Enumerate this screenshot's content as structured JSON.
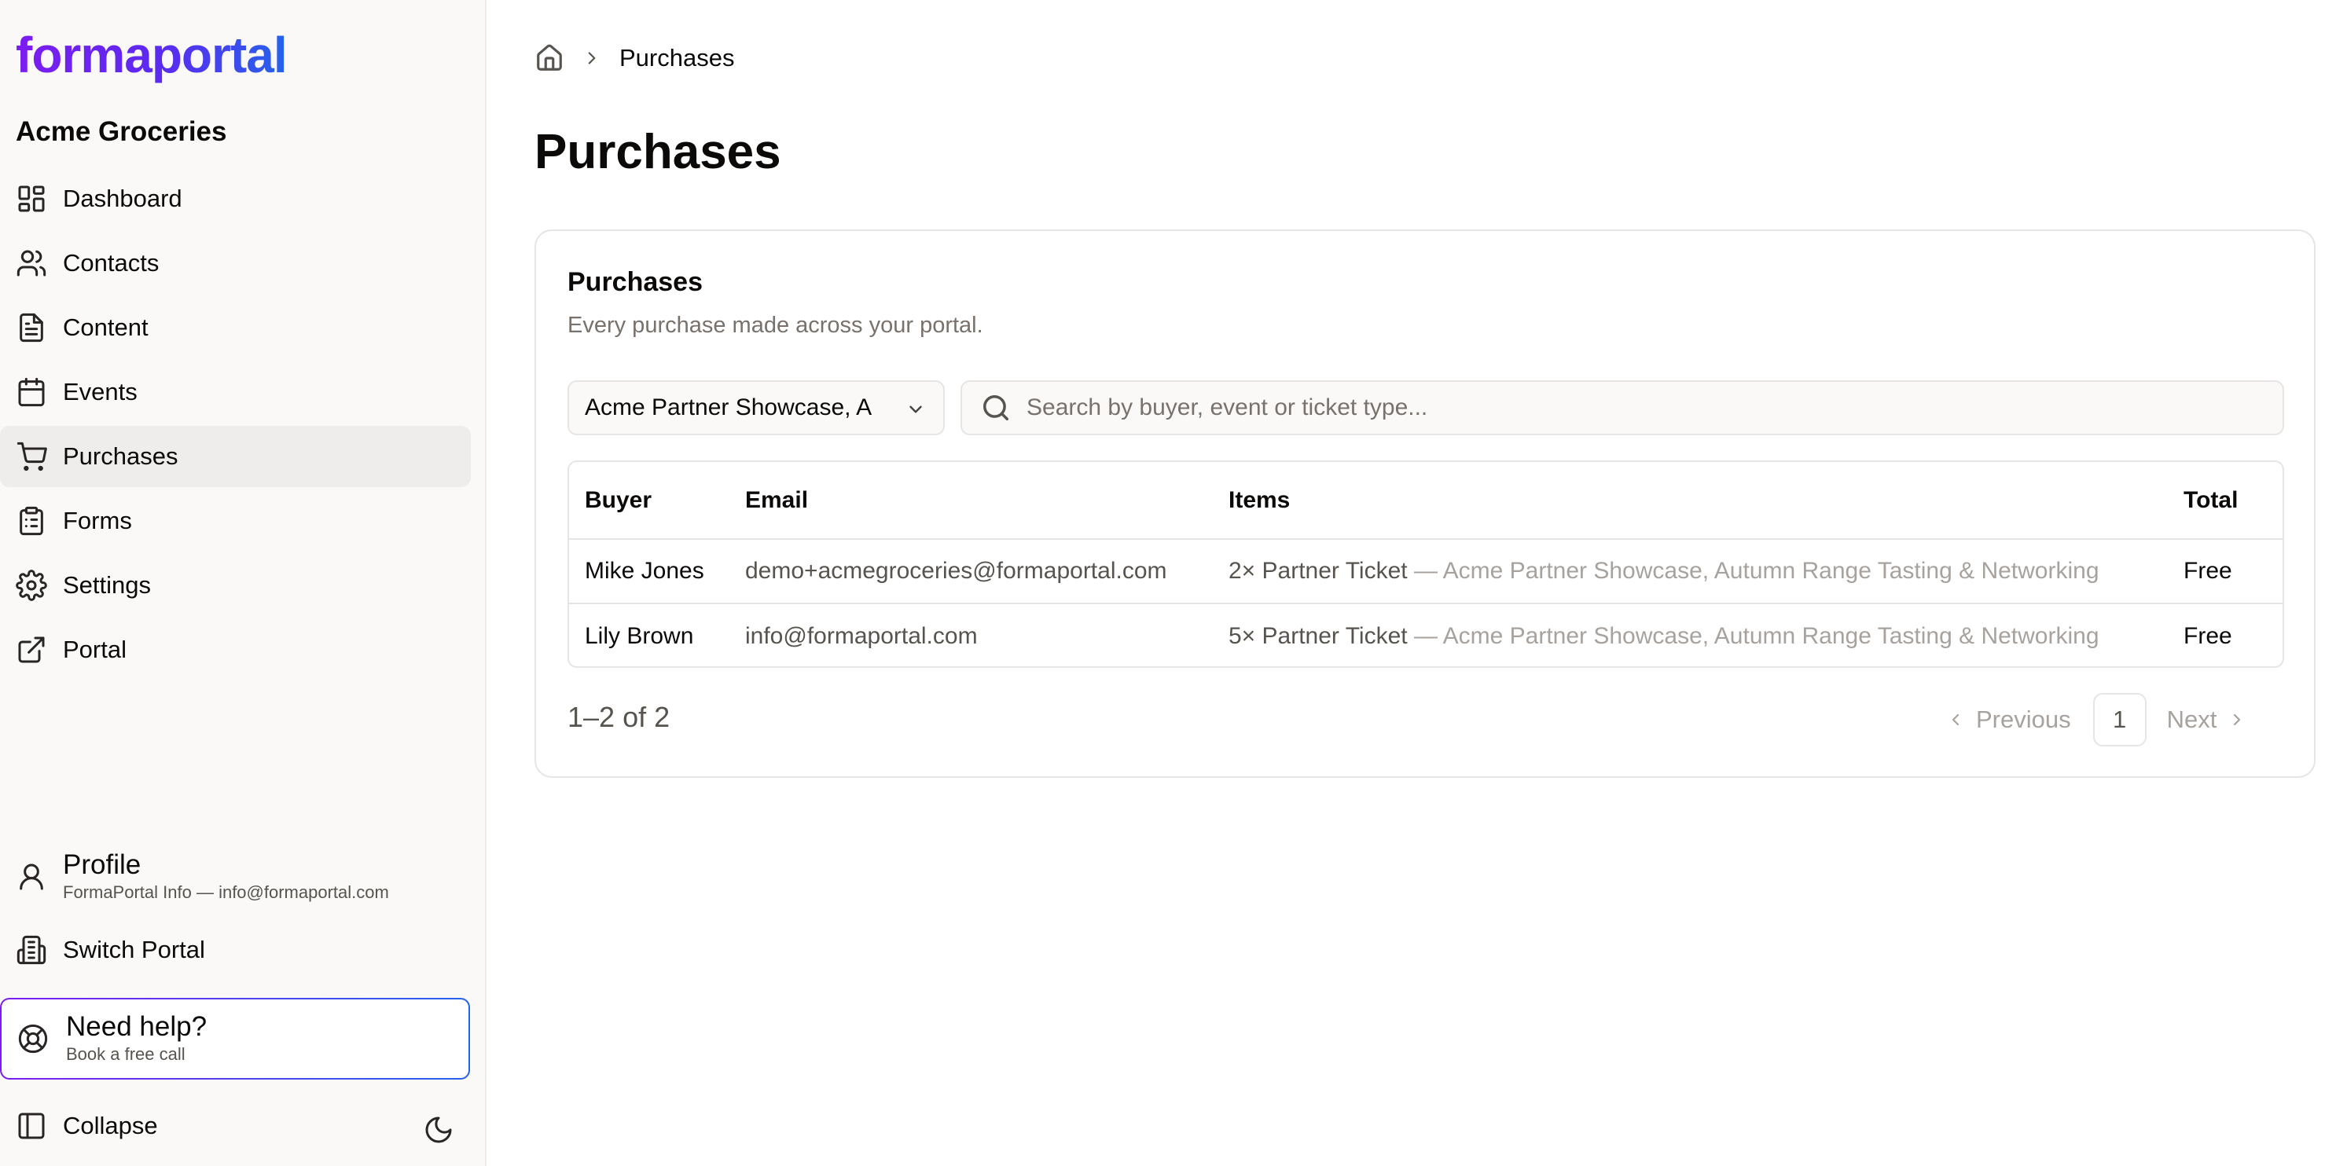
{
  "app": {
    "logo": "formaportal",
    "org_name": "Acme Groceries",
    "brand_gradient": [
      "#7c1cf0",
      "#2563eb"
    ]
  },
  "sidebar": {
    "items": [
      {
        "label": "Dashboard",
        "icon": "dashboard-icon",
        "active": false
      },
      {
        "label": "Contacts",
        "icon": "users-icon",
        "active": false
      },
      {
        "label": "Content",
        "icon": "document-icon",
        "active": false
      },
      {
        "label": "Events",
        "icon": "calendar-icon",
        "active": false
      },
      {
        "label": "Purchases",
        "icon": "cart-icon",
        "active": true
      },
      {
        "label": "Forms",
        "icon": "clipboard-icon",
        "active": false
      },
      {
        "label": "Settings",
        "icon": "gear-icon",
        "active": false
      },
      {
        "label": "Portal",
        "icon": "external-link-icon",
        "active": false
      }
    ],
    "profile": {
      "title": "Profile",
      "subtitle": "FormaPortal Info — info@formaportal.com"
    },
    "switch_portal": "Switch Portal",
    "help": {
      "title": "Need help?",
      "subtitle": "Book a free call"
    },
    "collapse": "Collapse"
  },
  "breadcrumb": {
    "current": "Purchases"
  },
  "page": {
    "title": "Purchases"
  },
  "card": {
    "title": "Purchases",
    "subtitle": "Every purchase made across your portal.",
    "event_filter": "Acme Partner Showcase, A",
    "search_placeholder": "Search by buyer, event or ticket type...",
    "table": {
      "columns": [
        "Buyer",
        "Email",
        "Items",
        "Total"
      ],
      "rows": [
        {
          "buyer": "Mike Jones",
          "email": "demo+acmegroceries@formaportal.com",
          "items_qty": "2× Partner Ticket",
          "items_event": "— Acme Partner Showcase, Autumn Range Tasting & Networking",
          "total": "Free"
        },
        {
          "buyer": "Lily Brown",
          "email": "info@formaportal.com",
          "items_qty": "5× Partner Ticket",
          "items_event": "— Acme Partner Showcase, Autumn Range Tasting & Networking",
          "total": "Free"
        }
      ]
    },
    "pagination": {
      "range": "1–2 of 2",
      "previous": "Previous",
      "page": "1",
      "next": "Next"
    }
  }
}
